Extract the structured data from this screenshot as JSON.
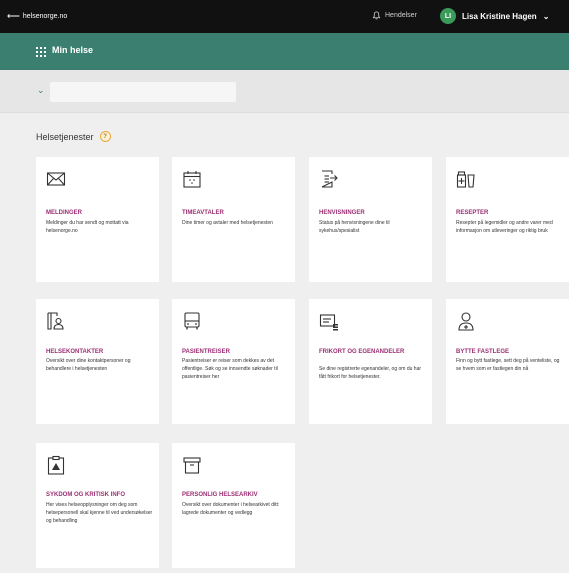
{
  "topbar": {
    "back_label": "helsenorge.no",
    "events_label": "Hendelser",
    "user_initials": "LI",
    "user_name": "Lisa Kristine Hagen"
  },
  "titlebar": {
    "title": "Min helse"
  },
  "section": {
    "title": "Helsetjenester",
    "help": "?"
  },
  "cards": [
    {
      "title": "MELDINGER",
      "desc": "Meldinger du har sendt og mottatt via helsenorge.no",
      "icon": "envelope-icon"
    },
    {
      "title": "TIMEAVTALER",
      "desc": "Dine timer og avtaler med helsetjenesten",
      "icon": "calendar-icon"
    },
    {
      "title": "HENVISNINGER",
      "desc": "Status på henvisningene dine til sykehus/spesialist",
      "icon": "referral-document-icon"
    },
    {
      "title": "RESEPTER",
      "desc": "Resepter på legemidler og andre varer med informasjon om utleveringer og riktig bruk",
      "icon": "prescription-icon"
    },
    {
      "title": "HELSEKONTAKTER",
      "desc": "Oversikt over dine kontaktpersoner og behandlere i helsetjenesten",
      "icon": "contacts-icon"
    },
    {
      "title": "PASIENTREISER",
      "desc": "Pasientreiser er reiser som dekkes av det offentlige. Søk og se innsendte søknader til pasientreiser her",
      "icon": "bus-icon"
    },
    {
      "title": "FRIKORT OG EGENANDELER",
      "desc": "Se dine registrerte egenandeler, og om du har fått frikort for helsetjenester.",
      "icon": "card-coins-icon"
    },
    {
      "title": "BYTTE FASTLEGE",
      "desc": "Finn og bytt fastlege, sett deg på venteliste, og se hvem som er fastlegen din nå",
      "icon": "doctor-icon"
    },
    {
      "title": "SYKDOM OG KRITISK INFO",
      "desc": "Her vises helseopplysninger om deg som helsepersonell skal kjenne til ved undersøkelser og behandling",
      "icon": "critical-info-icon"
    },
    {
      "title": "PERSONLIG HELSEARKIV",
      "desc": "Oversikt over dokumenter i helsearkivet ditt: lagrede dokumenter og vedlegg",
      "icon": "archive-box-icon"
    }
  ]
}
